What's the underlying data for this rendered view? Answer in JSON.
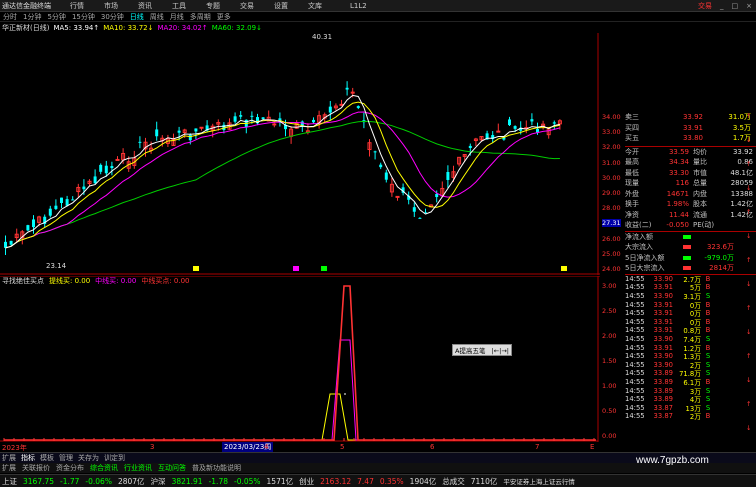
{
  "titlebar": {
    "app": "通达信金融终端",
    "menus": [
      "行情",
      "市场",
      "资讯",
      "工具",
      "专题",
      "交易",
      "设置",
      "文库"
    ],
    "center": "L1L2",
    "trade": "交易"
  },
  "periods": [
    {
      "label": "分时",
      "sel": false
    },
    {
      "label": "1分钟",
      "sel": false
    },
    {
      "label": "5分钟",
      "sel": false
    },
    {
      "label": "15分钟",
      "sel": false
    },
    {
      "label": "30分钟",
      "sel": false
    },
    {
      "label": "日线",
      "sel": true
    },
    {
      "label": "周线",
      "sel": false
    },
    {
      "label": "月线",
      "sel": false
    },
    {
      "label": "多周期",
      "sel": false
    },
    {
      "label": "更多",
      "sel": false
    }
  ],
  "ma": {
    "name": "华正新材(日线)",
    "ma5": "MA5: 33.94↑",
    "ma10": "MA10: 33.72↓",
    "ma20": "MA20: 34.02↑",
    "ma60": "MA60: 32.09↓"
  },
  "annot": {
    "high": "40.31",
    "low": "23.14"
  },
  "price_axis": [
    "34.00",
    "33.00",
    "32.00",
    "31.00",
    "30.00",
    "29.00",
    "28.00",
    "27.31",
    "26.00",
    "25.00",
    "24.00"
  ],
  "ind": {
    "title": "寻找绝佳买点",
    "l1": "提线买: 0.00",
    "l2": "中线买: 0.00",
    "l3": "中线买点: 0.00",
    "axis": [
      "3.00",
      "2.50",
      "2.00",
      "1.50",
      "1.00",
      "0.50",
      "0.00"
    ],
    "tooltip": "A提高五笔"
  },
  "date_axis": {
    "left": "2023年",
    "mid": "2023/03/23周",
    "marks": [
      "3",
      "4",
      "5",
      "6",
      "7"
    ],
    "right": "E"
  },
  "quote": {
    "asks": [
      {
        "l": "卖三",
        "p": "33.92",
        "v": "31.0万"
      },
      {
        "l": "买四",
        "p": "33.91",
        "v": "3.5万"
      },
      {
        "l": "买五",
        "p": "33.80",
        "v": "1.7万"
      }
    ],
    "stats": [
      {
        "l": "今开",
        "v": "33.59",
        "l2": "均价",
        "v2": "33.92"
      },
      {
        "l": "最高",
        "v": "34.34",
        "l2": "量比",
        "v2": "0.86"
      },
      {
        "l": "最低",
        "v": "33.30",
        "l2": "市值",
        "v2": "48.1亿"
      },
      {
        "l": "现量",
        "v": "116",
        "l2": "总量",
        "v2": "28059"
      },
      {
        "l": "外盘",
        "v": "14671",
        "l2": "内盘",
        "v2": "13388"
      },
      {
        "l": "换手",
        "v": "1.98%",
        "l2": "股本",
        "v2": "1.42亿"
      },
      {
        "l": "净资",
        "v": "11.44",
        "l2": "流通",
        "v2": "1.42亿"
      },
      {
        "l": "收益(二)",
        "v": "-0.050",
        "l2": "PE(动)",
        "v2": ""
      }
    ],
    "flows": [
      {
        "l": "净流入额",
        "v": "",
        "c": "green"
      },
      {
        "l": "大宗流入",
        "v": "323.6万",
        "c": "red"
      },
      {
        "l": "5日净流入额",
        "v": "-979.0万",
        "c": "green"
      },
      {
        "l": "5日大宗流入",
        "v": "2814万",
        "c": "red"
      }
    ],
    "ticks": [
      {
        "t": "14:55",
        "p": "33.90",
        "v": "2.7万",
        "s": "B"
      },
      {
        "t": "14:55",
        "p": "33.91",
        "v": "5万",
        "s": "B"
      },
      {
        "t": "14:55",
        "p": "33.90",
        "v": "3.1万",
        "s": "S"
      },
      {
        "t": "14:55",
        "p": "33.91",
        "v": "0万",
        "s": "B"
      },
      {
        "t": "14:55",
        "p": "33.91",
        "v": "0万",
        "s": "B"
      },
      {
        "t": "14:55",
        "p": "33.91",
        "v": "0万",
        "s": "B"
      },
      {
        "t": "14:55",
        "p": "33.91",
        "v": "0.8万",
        "s": "B"
      },
      {
        "t": "14:55",
        "p": "33.90",
        "v": "7.4万",
        "s": "S"
      },
      {
        "t": "14:55",
        "p": "33.91",
        "v": "1.2万",
        "s": "B"
      },
      {
        "t": "14:55",
        "p": "33.90",
        "v": "1.3万",
        "s": "S"
      },
      {
        "t": "14:55",
        "p": "33.90",
        "v": "2万",
        "s": "S"
      },
      {
        "t": "14:55",
        "p": "33.89",
        "v": "71.8万",
        "s": "S"
      },
      {
        "t": "14:55",
        "p": "33.89",
        "v": "6.1万",
        "s": "B"
      },
      {
        "t": "14:55",
        "p": "33.89",
        "v": "3万",
        "s": "S"
      },
      {
        "t": "14:55",
        "p": "33.89",
        "v": "4万",
        "s": "S"
      },
      {
        "t": "14:55",
        "p": "33.87",
        "v": "13万",
        "s": "S"
      },
      {
        "t": "14:55",
        "p": "33.87",
        "v": "2万",
        "s": "B"
      }
    ]
  },
  "toolbar": [
    "扩展",
    {
      "t": "指标",
      "c": "white"
    },
    "模板",
    "管理",
    "关存为",
    "训定到"
  ],
  "tabs": [
    {
      "t": "扩展",
      "hl": false
    },
    {
      "t": "关联报价",
      "hl": false
    },
    {
      "t": "资金分布",
      "hl": false
    },
    {
      "t": "综合资讯",
      "hl": true
    },
    {
      "t": "行业资讯",
      "hl": true
    },
    {
      "t": "互动问答",
      "hl": true
    },
    {
      "t": "普及新功能说明",
      "hl": false
    }
  ],
  "status": {
    "sh_l": "上证",
    "sh_v": "3167.75",
    "sh_c": "-1.77",
    "sh_p": "-0.06%",
    "sh_a": "2807亿",
    "sz_l": "沪深",
    "sz_v": "3821.91",
    "sz_c": "-1.78",
    "sz_p": "-0.05%",
    "sz_a": "1571亿",
    "cy_l": "创业",
    "cy_v": "2163.12",
    "cy_c": "7.47",
    "cy_p": "0.35%",
    "cy_a": "1904亿",
    "tot_l": "总成交",
    "tot_v": "7110亿",
    "broker": "平安证券上海上证云行情"
  },
  "watermark": "www.7gpzb.com"
}
